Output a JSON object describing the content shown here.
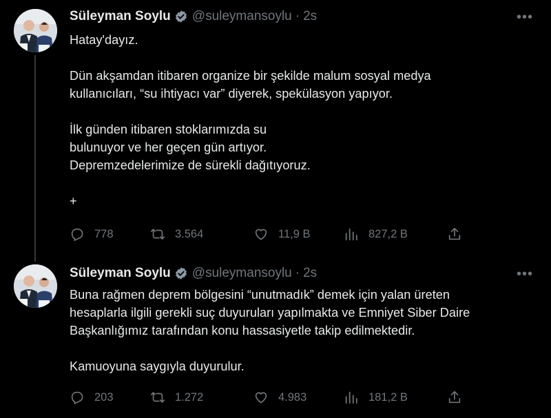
{
  "tweets": [
    {
      "name": "Süleyman Soylu",
      "handle": "@suleymansoylu",
      "separator": "·",
      "time": "2s",
      "paragraphs": [
        "Hatay'dayız.",
        "Dün akşamdan itibaren organize bir şekilde malum sosyal medya\nkullanıcıları, “su ihtiyacı var” diyerek, spekülasyon yapıyor.",
        "İlk günden itibaren stoklarımızda su\nbulunuyor ve her geçen gün artıyor.\nDepremzedelerimize de sürekli dağıtıyoruz.",
        "+"
      ],
      "stats": {
        "replies": "778",
        "retweets": "3.564",
        "likes": "11,9 B",
        "views": "827,2 B"
      }
    },
    {
      "name": "Süleyman Soylu",
      "handle": "@suleymansoylu",
      "separator": "·",
      "time": "2s",
      "paragraphs": [
        "Buna rağmen deprem bölgesini “unutmadık” demek için yalan üreten\nhesaplarla ilgili gerekli suç duyuruları yapılmakta ve Emniyet Siber Daire\nBaşkanlığımız tarafından konu hassasiyetle takip edilmektedir.",
        "Kamuoyuna saygıyla duyurulur."
      ],
      "stats": {
        "replies": "203",
        "retweets": "1.272",
        "likes": "4.983",
        "views": "181,2 B"
      }
    }
  ],
  "icons": [
    "verified-badge-icon",
    "more-icon",
    "reply-icon",
    "retweet-icon",
    "like-icon",
    "views-icon",
    "share-icon"
  ],
  "colors": {
    "background": "#000000",
    "text": "#e7e9ea",
    "muted": "#71767b",
    "verified": "#8b98a5"
  }
}
